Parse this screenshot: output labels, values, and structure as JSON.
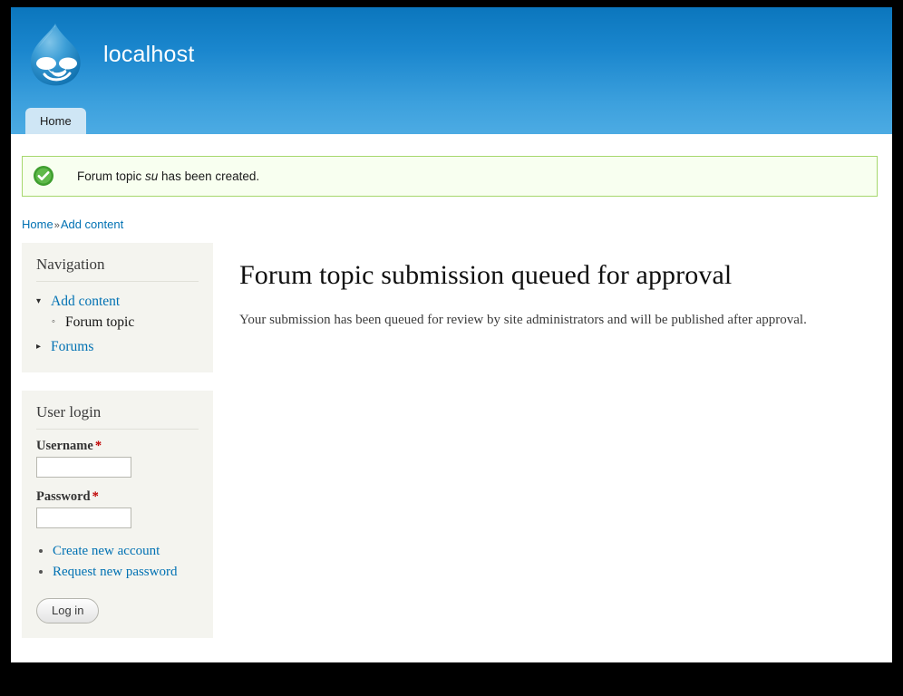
{
  "site": {
    "name": "localhost",
    "logo_icon": "drupal-droplet-logo"
  },
  "main_menu": {
    "items": [
      {
        "label": "Home",
        "active": true
      }
    ]
  },
  "status_message": {
    "icon": "check-circle-icon",
    "text_before": "Forum topic ",
    "emphasis": "su",
    "text_after": " has been created.",
    "border_color": "#a6d86e",
    "background_color": "#f8fff0",
    "icon_color": "#3f9e2f"
  },
  "breadcrumb": {
    "items": [
      "Home",
      "Add content"
    ],
    "separator": "»"
  },
  "sidebar": {
    "navigation_block": {
      "title": "Navigation",
      "items": [
        {
          "label": "Add content",
          "marker": "triangle-down-icon",
          "is_link": true,
          "children": [
            {
              "label": "Forum topic",
              "marker": "circle-bullet-icon",
              "is_link": false
            }
          ]
        },
        {
          "label": "Forums",
          "marker": "triangle-right-icon",
          "is_link": true,
          "children": []
        }
      ]
    },
    "user_login_block": {
      "title": "User login",
      "username_label": "Username",
      "username_value": "",
      "password_label": "Password",
      "password_value": "",
      "required_marker": "*",
      "links": [
        "Create new account",
        "Request new password"
      ],
      "submit_label": "Log in"
    }
  },
  "main": {
    "title": "Forum topic submission queued for approval",
    "body": "Your submission has been queued for review by site administrators and will be published after approval."
  },
  "theme": {
    "header_gradient_top": "#0b76bd",
    "header_gradient_bottom": "#4cabe3",
    "tab_background": "#cfe6f5",
    "link_color": "#0071b3",
    "block_background": "#f4f4ef",
    "page_background": "#ffffff",
    "frame_color": "#000000"
  }
}
